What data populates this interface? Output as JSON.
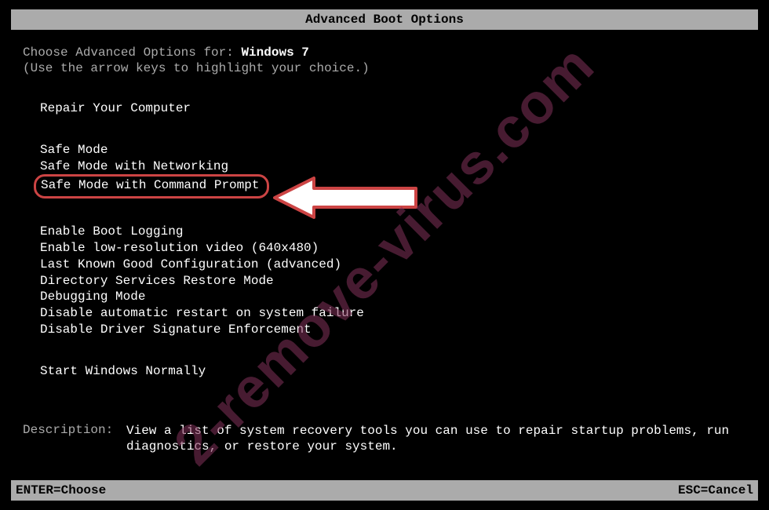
{
  "title": "Advanced Boot Options",
  "intro": {
    "prefix": "Choose Advanced Options for: ",
    "os": "Windows 7",
    "hint": "(Use the arrow keys to highlight your choice.)"
  },
  "sections": {
    "repair": "Repair Your Computer",
    "safe": [
      "Safe Mode",
      "Safe Mode with Networking",
      "Safe Mode with Command Prompt"
    ],
    "advanced": [
      "Enable Boot Logging",
      "Enable low-resolution video (640x480)",
      "Last Known Good Configuration (advanced)",
      "Directory Services Restore Mode",
      "Debugging Mode",
      "Disable automatic restart on system failure",
      "Disable Driver Signature Enforcement"
    ],
    "normal": "Start Windows Normally"
  },
  "description": {
    "label": "Description:",
    "text": "View a list of system recovery tools you can use to repair startup problems, run diagnostics, or restore your system."
  },
  "footer": {
    "enter": "ENTER=Choose",
    "esc": "ESC=Cancel"
  },
  "watermark": "2-remove-virus.com"
}
